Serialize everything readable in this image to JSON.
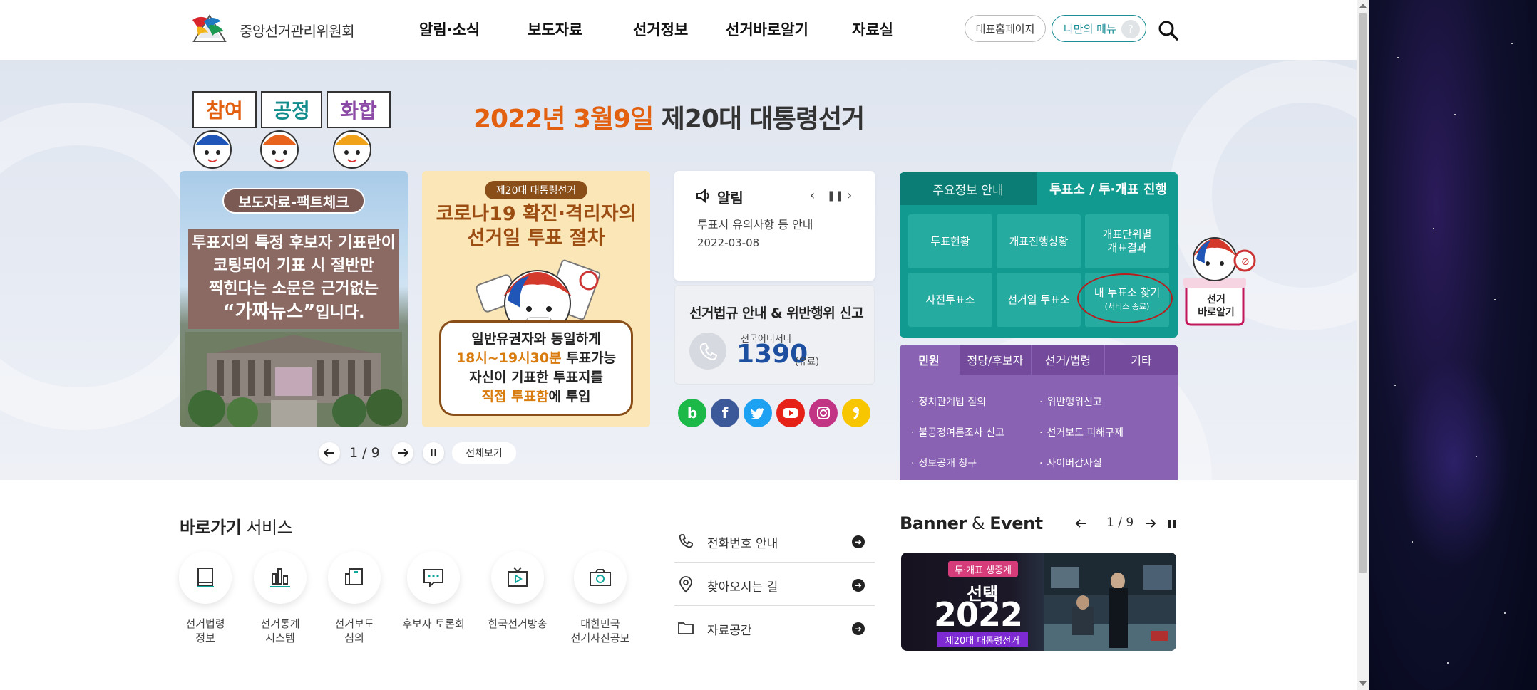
{
  "header": {
    "org_name": "중앙선거관리위원회",
    "nav": [
      "알림·소식",
      "보도자료",
      "선거정보",
      "선거바로알기",
      "자료실"
    ],
    "btn_home": "대표홈페이지",
    "btn_mymenu": "나만의 메뉴",
    "btn_help": "?"
  },
  "hero": {
    "signs": [
      "참여",
      "공정",
      "화합"
    ],
    "title_date": "2022년 3월9일",
    "title_name": "제20대 대통령선거",
    "card_fact": {
      "tag": "보도자료-팩트체크",
      "line1": "투표지의 특정 후보자 기표란이",
      "line2": "코팅되어 기표 시 절반만",
      "line3": "찍힌다는 소문은 근거없는",
      "line4_quote": "“가짜뉴스”",
      "line4_rest": "입니다."
    },
    "card_covid": {
      "tag": "제20대 대통령선거",
      "title1": "코로나19 확진·격리자의",
      "title2": "선거일 투표 절차",
      "box1": "일반유권자와 동일하게",
      "box2a": "18시~19시30분",
      "box2b": " 투표가능",
      "box3": "자신이 기표한 투표지를",
      "box4a": "직접 투표함",
      "box4b": "에 투입"
    },
    "pager": {
      "text": "1 / 9",
      "all_label": "전체보기"
    },
    "notice": {
      "title": "알림",
      "item": "투표시 유의사항 등 안내",
      "date": "2022-03-08"
    },
    "report": {
      "title": "선거법규 안내 & 위반행위 신고",
      "sub": "전국어디서나",
      "number": "1390",
      "paid": "(유료)"
    },
    "vote": {
      "tab1": "주요정보 안내",
      "tab2": "투표소 / 투·개표 진행",
      "cells": [
        "투표현황",
        "개표진행상황",
        "개표단위별\n개표결과",
        "사전투표소",
        "선거일 투표소"
      ],
      "find_main": "내 투표소 찾기",
      "find_sub": "(서비스 종료)"
    },
    "mascot_sign": "선거\n바로알기",
    "civil": {
      "tabs": [
        "민원",
        "정당/후보자",
        "선거/법령",
        "기타"
      ],
      "links": [
        "정치관계법 질의",
        "위반행위신고",
        "불공정여론조사 신고",
        "선거보도 피해구제",
        "정보공개 청구",
        "사이버감사실"
      ]
    }
  },
  "quick": {
    "title_bold": "바로가기",
    "title_rest": " 서비스",
    "items": [
      "선거법령\n정보",
      "선거통계\n시스템",
      "선거보도\n심의",
      "후보자 토론회",
      "한국선거방송",
      "대한민국\n선거사진공모"
    ]
  },
  "links": [
    "전화번호 안내",
    "찾아오시는 길",
    "자료공간"
  ],
  "banner": {
    "title_bold1": "Banner",
    "title_mid": " & ",
    "title_bold2": "Event",
    "pager": "1 / 9",
    "tag": "투·개표 생중계",
    "word1": "선택",
    "word2": "2022",
    "word3": "제20대 대통령선거"
  },
  "colors": {
    "accent_teal": "#119a8f",
    "accent_purple": "#8a62b3",
    "date_orange": "#e2600f",
    "hotline_blue": "#1d4fa0"
  }
}
